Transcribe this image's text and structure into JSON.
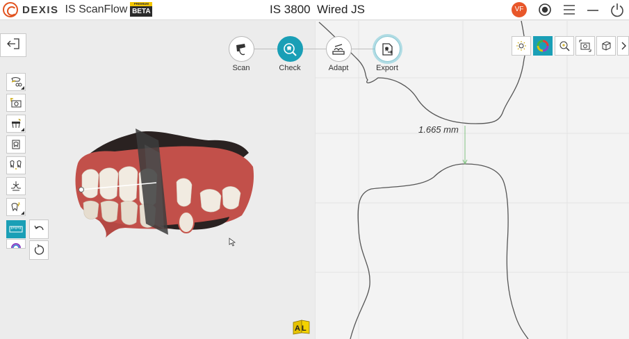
{
  "app": {
    "brand": "DEXIS",
    "product": "IS ScanFlow",
    "premium_label": "PREMIUM",
    "beta_label": "BETA",
    "device_title": "IS 3800  Wired JS",
    "user_initials": "VF",
    "colors": {
      "accent": "#1a9fb6",
      "brand": "#e2531f",
      "avatar": "#e8572a"
    }
  },
  "header_icons": [
    "record-icon",
    "menu-icon",
    "minimize-icon",
    "power-icon"
  ],
  "workflow": {
    "steps": [
      {
        "label": "Scan",
        "icon": "scanner-icon",
        "state": "default"
      },
      {
        "label": "Check",
        "icon": "tooth-check-icon",
        "state": "active"
      },
      {
        "label": "Adapt",
        "icon": "adapt-icon",
        "state": "default"
      },
      {
        "label": "Export",
        "icon": "export-icon",
        "state": "highlight"
      }
    ]
  },
  "left_tools": [
    {
      "name": "edit-tool",
      "icon": "pencil-cut-icon",
      "has_submenu": true
    },
    {
      "name": "snapshot-tool",
      "icon": "camera-icon",
      "has_submenu": false
    },
    {
      "name": "tooth-tool",
      "icon": "tooth-icon",
      "has_submenu": true
    },
    {
      "name": "crown-tool",
      "icon": "crown-icon",
      "has_submenu": false
    },
    {
      "name": "arch-tool",
      "icon": "arch-icon",
      "has_submenu": false
    },
    {
      "name": "occlusion-tool",
      "icon": "occlusion-icon",
      "has_submenu": false
    },
    {
      "name": "tooth-mark-tool",
      "icon": "tooth-spark-icon",
      "has_submenu": true
    },
    {
      "name": "ruler-tool",
      "icon": "ruler-icon",
      "has_submenu": false,
      "active": true
    },
    {
      "name": "color-tool",
      "icon": "rainbow-icon",
      "has_submenu": false
    }
  ],
  "history": {
    "undo_icon": "undo-icon",
    "reset_icon": "reset-icon"
  },
  "right_toolbar": [
    {
      "name": "light-tool",
      "icon": "sun-icon"
    },
    {
      "name": "color-map-tool",
      "icon": "color-wheel-icon",
      "active": true
    },
    {
      "name": "zoom-tool",
      "icon": "zoom-icon"
    },
    {
      "name": "screenshot-tool",
      "icon": "camera-frame-icon"
    },
    {
      "name": "view-cube-tool",
      "icon": "cube-icon"
    },
    {
      "name": "collapse-toolbar",
      "icon": "chevron-right-icon"
    }
  ],
  "measurement": {
    "distance_text": "1.665 mm"
  },
  "badge": {
    "letters": "AL"
  }
}
